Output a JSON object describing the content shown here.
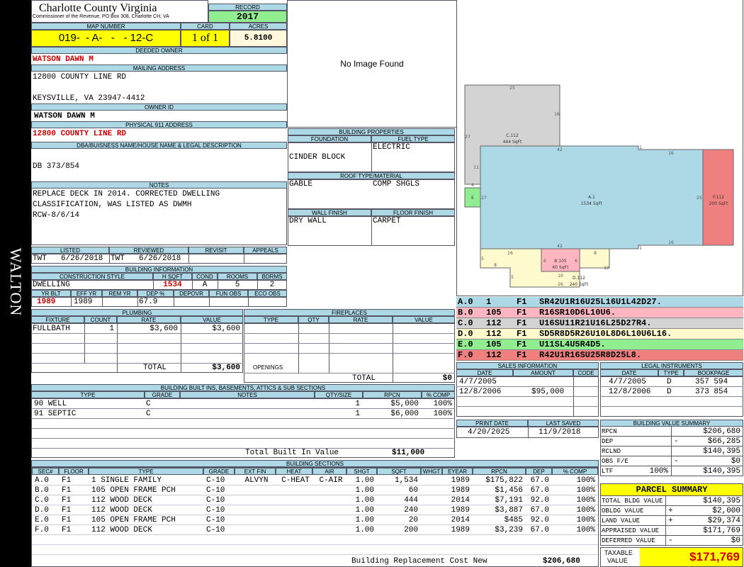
{
  "sidebar": {
    "district": "WALTON"
  },
  "header": {
    "county": "Charlotte County Virginia",
    "commissioner": "Commissioner of the Revenue, PO Box 308, Charlotte CH, VA",
    "record_label": "RECORD",
    "record_year": "2017",
    "map_number_label": "MAP NUMBER",
    "map_number": "019-  - A-   -   - 12-C",
    "card_label": "CARD",
    "card": "1 of 1",
    "acres_label": "ACRES",
    "acres": "5.8100"
  },
  "owner": {
    "deeded_owner_label": "DEEDED OWNER",
    "deeded_owner": "WATSON DAWN M",
    "mailing_address_label": "MAILING ADDRESS",
    "mailing_line1": "12800 COUNTY LINE RD",
    "mailing_line2": "KEYSVILLE, VA 23947-4412",
    "owner_id_label": "OWNER ID",
    "owner_id": "WATSON DAWN M",
    "physical_address_label": "PHYSICAL 911 ADDRESS",
    "physical_address": "12800 COUNTY LINE RD",
    "legal_label": "DBA/BUISNESS NAME/HOUSE NAME & LEGAL DESCRIPTION",
    "legal": "DB 373/854",
    "notes_label": "NOTES",
    "notes": [
      "REPLACE DECK IN 2014. CORRECTED DWELLING",
      "CLASSIFICATION, WAS LISTED AS DWMH",
      "RCW-8/6/14"
    ]
  },
  "review": {
    "listed_label": "LISTED",
    "listed_by": "TWT",
    "listed_date": "6/26/2018",
    "reviewed_label": "REVIEWED",
    "reviewed_by": "TWT",
    "reviewed_date": "6/26/2018",
    "revisit_label": "REVISIT",
    "appeals_label": "APPEALS"
  },
  "building_info": {
    "section_label": "BUILDING INFORMATION",
    "construction_style_label": "CONSTRUCTION STYLE",
    "construction_style": "DWELLING",
    "hsqft_label": "H SQFT",
    "hsqft": "1534",
    "cond_label": "COND",
    "cond": "A",
    "rooms_label": "ROOMS",
    "rooms": "5",
    "bdrms_label": "BDRMS",
    "bdrms": "2",
    "yr_blt_label": "YR BLT",
    "yr_blt": "1989",
    "eff_yr_label": "EFF YR",
    "eff_yr": "1989",
    "rem_yr_label": "REM YR",
    "dep_label": "DEP %",
    "dep": "67.9",
    "depovr_label": "DEPOVR",
    "fun_obs_label": "FUN OBS",
    "eco_obs_label": "ECO OBS"
  },
  "image": {
    "no_image": "No Image Found"
  },
  "building_properties": {
    "section_label": "BUILDING PROPERTIES",
    "foundation_label": "FOUNDATION",
    "foundation": "CINDER BLOCK",
    "fuel_label": "FUEL TYPE",
    "fuel": "ELECTRIC",
    "roof_label": "ROOF TYPE/MATERIAL",
    "roof_type": "GABLE",
    "roof_material": "COMP SHGLS",
    "wall_label": "WALL FINISH",
    "wall": "DRY WALL",
    "floor_label": "FLOOR FINISH",
    "floor": "CARPET"
  },
  "sketch": {
    "labels": {
      "c": "C.112",
      "c_area": "444 SqFt",
      "a": "A.1",
      "a_area": "1534 SqFt",
      "f": "F.112",
      "f_area": "200 SqFt",
      "b": "B.105",
      "b_area": "60 SqFt",
      "d": "D.112",
      "d_area": "240 SqFt",
      "e": "E"
    },
    "dims": [
      "25",
      "16",
      "27",
      "11",
      "4",
      "42",
      "1",
      "16",
      "25",
      "27",
      "42",
      "1",
      "16",
      "16",
      "6",
      "5",
      "8",
      "6",
      "8",
      "10",
      "10",
      "26",
      "5"
    ],
    "colors": {
      "a": "#add8e6",
      "b": "#ffb6c1",
      "c": "#d3d3d3",
      "d": "#fffacd",
      "e": "#90ee90",
      "f": "#f08080"
    }
  },
  "segments": [
    {
      "sec": "A.0",
      "code": "1",
      "floor": "F1",
      "path": "SR42U1R16U25L16U1L42D27.",
      "color": "#add8e6"
    },
    {
      "sec": "B.0",
      "code": "105",
      "floor": "F1",
      "path": "R16SR10D6L10U6.",
      "color": "#ffb6c1"
    },
    {
      "sec": "C.0",
      "code": "112",
      "floor": "F1",
      "path": "U16SU11R21U16L25D27R4.",
      "color": "#d3d3d3"
    },
    {
      "sec": "D.0",
      "code": "112",
      "floor": "F1",
      "path": "SD5R8D5R26U10L8D6L10U6L16.",
      "color": "#fffacd"
    },
    {
      "sec": "E.0",
      "code": "105",
      "floor": "F1",
      "path": "U11SL4U5R4D5.",
      "color": "#90ee90"
    },
    {
      "sec": "F.0",
      "code": "112",
      "floor": "F1",
      "path": "R42U1R16SU25R8D25L8.",
      "color": "#f08080"
    }
  ],
  "plumbing": {
    "section_label": "PLUMBING",
    "headers": [
      "FIXTURE",
      "COUNT",
      "RATE",
      "VALUE"
    ],
    "rows": [
      {
        "fixture": "FULLBATH",
        "count": "1",
        "rate": "$3,600",
        "value": "$3,600"
      }
    ],
    "total_label": "TOTAL",
    "total": "$3,600"
  },
  "fireplaces": {
    "section_label": "FIREPLACES",
    "headers": [
      "TYPE",
      "QTY",
      "RATE",
      "VALUE"
    ],
    "openings_label": "OPENINGS",
    "total_label": "TOTAL",
    "total": "$0"
  },
  "sales": {
    "section_label": "SALES INFORMATION",
    "headers": [
      "DATE",
      "AMOUNT",
      "CODE"
    ],
    "rows": [
      {
        "date": "4/7/2005",
        "amount": "",
        "code": ""
      },
      {
        "date": "12/8/2006",
        "amount": "$95,000",
        "code": ""
      }
    ]
  },
  "legal_instruments": {
    "section_label": "LEGAL INSTRUMENTS",
    "headers": [
      "DATE",
      "TYPE",
      "BOOKPAGE"
    ],
    "rows": [
      {
        "date": "4/7/2005",
        "type": "D",
        "bookpage": "357 594"
      },
      {
        "date": "12/8/2006",
        "type": "D",
        "bookpage": "373 854"
      }
    ]
  },
  "print_info": {
    "print_date_label": "PRINT DATE",
    "print_date": "4/20/2025",
    "last_saved_label": "LAST SAVED",
    "last_saved": "11/9/2018"
  },
  "built_ins": {
    "section_label": "BUILDING BUILT INS, BASEMENTS, ATTICS & SUB SECTIONS",
    "headers": [
      "TYPE",
      "GRADE",
      "NOTES",
      "QTY/SIZE",
      "RPCN",
      "% COMP"
    ],
    "rows": [
      {
        "type": "90 WELL",
        "grade": "C",
        "notes": "",
        "qty": "1",
        "rpcn": "$5,000",
        "comp": "100%"
      },
      {
        "type": "91 SEPTIC",
        "grade": "C",
        "notes": "",
        "qty": "1",
        "rpcn": "$6,000",
        "comp": "100%"
      }
    ],
    "total_label": "Total Built In Value",
    "total": "$11,000"
  },
  "sections": {
    "section_label": "BUILDING SECTIONS",
    "headers": [
      "SEC#",
      "FLOOR",
      "TYPE",
      "GRADE",
      "EXT FIN",
      "HEAT",
      "AIR",
      "SHGT",
      "SQFT",
      "WHGT",
      "EYEAR",
      "RPCN",
      "DEP",
      "% COMP"
    ],
    "rows": [
      {
        "sec": "A.0",
        "floor": "F1",
        "type": "1 SINGLE FAMILY",
        "grade": "C-10",
        "ext": "ALVYN",
        "heat": "C-HEAT",
        "air": "C-AIR",
        "shgt": "1.00",
        "sqft": "1,534",
        "whgt": "",
        "eyear": "1989",
        "rpcn": "$175,822",
        "dep": "67.0",
        "comp": "100%"
      },
      {
        "sec": "B.0",
        "floor": "F1",
        "type": "105 OPEN FRAME PCH",
        "grade": "C-10",
        "ext": "",
        "heat": "",
        "air": "",
        "shgt": "1.00",
        "sqft": "60",
        "whgt": "",
        "eyear": "1989",
        "rpcn": "$1,456",
        "dep": "67.0",
        "comp": "100%"
      },
      {
        "sec": "C.0",
        "floor": "F1",
        "type": "112 WOOD DECK",
        "grade": "C-10",
        "ext": "",
        "heat": "",
        "air": "",
        "shgt": "1.00",
        "sqft": "444",
        "whgt": "",
        "eyear": "2014",
        "rpcn": "$7,191",
        "dep": "92.0",
        "comp": "100%"
      },
      {
        "sec": "D.0",
        "floor": "F1",
        "type": "112 WOOD DECK",
        "grade": "C-10",
        "ext": "",
        "heat": "",
        "air": "",
        "shgt": "1.00",
        "sqft": "240",
        "whgt": "",
        "eyear": "1989",
        "rpcn": "$3,887",
        "dep": "67.0",
        "comp": "100%"
      },
      {
        "sec": "E.0",
        "floor": "F1",
        "type": "105 OPEN FRAME PCH",
        "grade": "C-10",
        "ext": "",
        "heat": "",
        "air": "",
        "shgt": "1.00",
        "sqft": "20",
        "whgt": "",
        "eyear": "2014",
        "rpcn": "$485",
        "dep": "92.0",
        "comp": "100%"
      },
      {
        "sec": "F.0",
        "floor": "F1",
        "type": "112 WOOD DECK",
        "grade": "C-10",
        "ext": "",
        "heat": "",
        "air": "",
        "shgt": "1.00",
        "sqft": "200",
        "whgt": "",
        "eyear": "1989",
        "rpcn": "$3,239",
        "dep": "67.0",
        "comp": "100%"
      }
    ],
    "replacement_label": "Building Replacement Cost New",
    "replacement": "$206,680"
  },
  "value_summary": {
    "section_label": "BUILDING VALUE SUMMARY",
    "rows": [
      {
        "label": "RPCN",
        "sign": "",
        "pct": "",
        "value": "$206,680"
      },
      {
        "label": "DEP",
        "sign": "-",
        "pct": "",
        "value": "$66,285"
      },
      {
        "label": "RCLND",
        "sign": "",
        "pct": "",
        "value": "$140,395"
      },
      {
        "label": "OBS F/E",
        "sign": "-",
        "pct": "",
        "value": "$0"
      },
      {
        "label": "LTF",
        "sign": "",
        "pct": "100%",
        "value": "$140,395"
      }
    ]
  },
  "parcel_summary": {
    "title": "PARCEL SUMMARY",
    "rows": [
      {
        "label": "TOTAL BLDG VALUE",
        "sign": "",
        "value": "$140,395"
      },
      {
        "label": "OBLDG VALUE",
        "sign": "+",
        "value": "$2,000"
      },
      {
        "label": "LAND VALUE",
        "sign": "+",
        "value": "$29,374"
      },
      {
        "label": "APPRAISED VALUE",
        "sign": "",
        "value": "$171,769"
      },
      {
        "label": "DEFERRED VALUE",
        "sign": "-",
        "value": "$0"
      }
    ],
    "taxable_label_1": "TAXABLE",
    "taxable_label_2": "VALUE",
    "taxable_value": "$171,769"
  }
}
